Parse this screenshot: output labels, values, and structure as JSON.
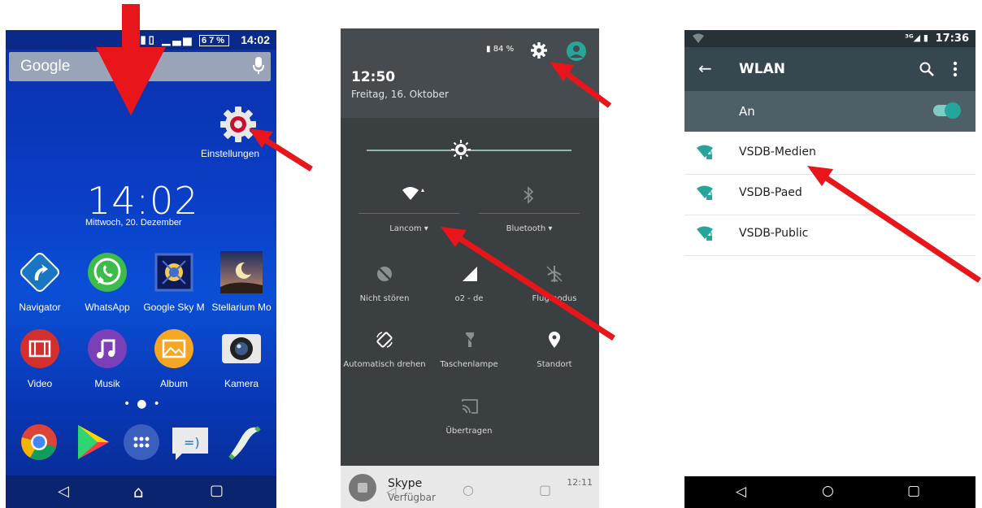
{
  "home": {
    "status_time": "14:02",
    "battery": "67%",
    "search_label": "Google",
    "settings_label": "Einstellungen",
    "clock": "14:02",
    "date": "Mittwoch, 20. Dezember",
    "apps_row1": [
      {
        "label": "Navigator",
        "icon": "navigator-icon"
      },
      {
        "label": "WhatsApp",
        "icon": "whatsapp-icon"
      },
      {
        "label": "Google Sky M",
        "icon": "sky-map-icon"
      },
      {
        "label": "Stellarium Mo",
        "icon": "stellarium-icon"
      }
    ],
    "apps_row2": [
      {
        "label": "Video",
        "icon": "video-icon"
      },
      {
        "label": "Musik",
        "icon": "music-icon"
      },
      {
        "label": "Album",
        "icon": "album-icon"
      },
      {
        "label": "Kamera",
        "icon": "camera-icon"
      }
    ],
    "dock": [
      "chrome-icon",
      "play-store-icon",
      "app-drawer-icon",
      "messaging-icon",
      "phone-icon"
    ]
  },
  "quick_settings": {
    "battery": "84 %",
    "time": "12:50",
    "date": "Freitag, 16. Oktober",
    "wifi_label": "Lancom",
    "bluetooth_label": "Bluetooth",
    "tiles": [
      {
        "label": "Nicht stören",
        "icon": "dnd-icon"
      },
      {
        "label": "o2 - de",
        "icon": "signal-icon"
      },
      {
        "label": "Flugmodus",
        "icon": "airplane-icon"
      },
      {
        "label": "Automatisch drehen",
        "icon": "rotate-icon"
      },
      {
        "label": "Taschenlampe",
        "icon": "flashlight-icon"
      },
      {
        "label": "Standort",
        "icon": "location-icon"
      },
      {
        "label": "Übertragen",
        "icon": "cast-icon"
      }
    ],
    "notification": {
      "title": "Skype",
      "subtitle": "Verfügbar",
      "time": "12:11"
    }
  },
  "wlan": {
    "status_time": "17:36",
    "title": "WLAN",
    "toggle_label": "An",
    "networks": [
      "VSDB-Medien",
      "VSDB-Paed",
      "VSDB-Public"
    ]
  },
  "colors": {
    "arrow": "#e8161b",
    "teal": "#26a69a"
  }
}
